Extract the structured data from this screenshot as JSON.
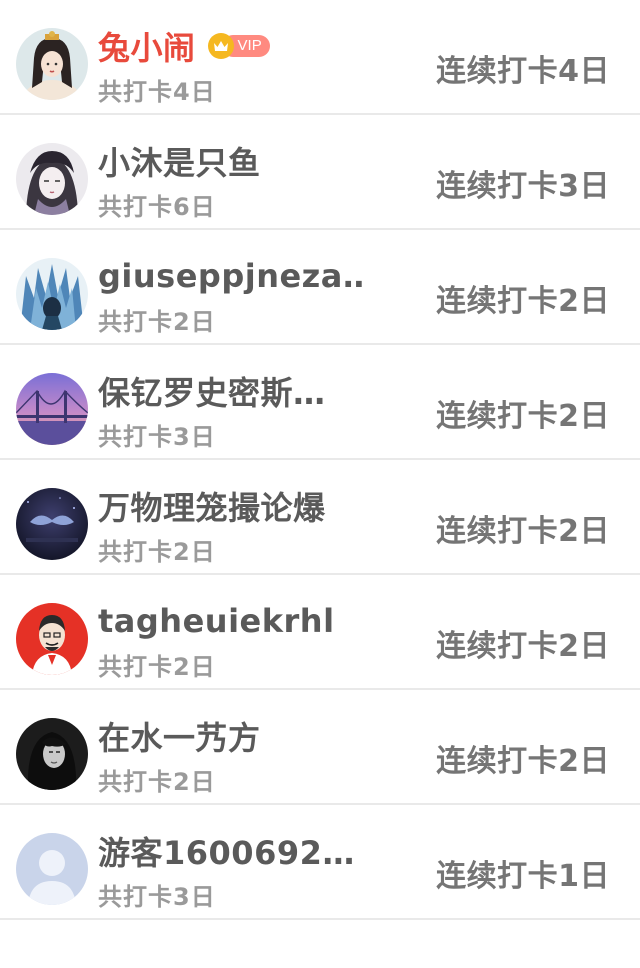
{
  "list": [
    {
      "name": "兔小闹",
      "vip": true,
      "vip_label": "VIP",
      "total": "共打卡4日",
      "streak": "连续打卡4日",
      "avatar": "avatar-girl-ancient-icon"
    },
    {
      "name": "小沐是只鱼",
      "vip": false,
      "total": "共打卡6日",
      "streak": "连续打卡3日",
      "avatar": "avatar-ink-girl-icon"
    },
    {
      "name": "giuseppjneza…",
      "vip": false,
      "total": "共打卡2日",
      "streak": "连续打卡2日",
      "avatar": "avatar-blue-hair-icon"
    },
    {
      "name": "保钇罗史密斯…",
      "vip": false,
      "total": "共打卡3日",
      "streak": "连续打卡2日",
      "avatar": "avatar-bridge-sunset-icon"
    },
    {
      "name": "万物理笼撮论爆",
      "vip": false,
      "total": "共打卡2日",
      "streak": "连续打卡2日",
      "avatar": "avatar-mustache-icon"
    },
    {
      "name": "tagheuiekrhl",
      "vip": false,
      "total": "共打卡2日",
      "streak": "连续打卡2日",
      "avatar": "avatar-red-man-icon"
    },
    {
      "name": "在水一艿方",
      "vip": false,
      "total": "共打卡2日",
      "streak": "连续打卡2日",
      "avatar": "avatar-dark-portrait-icon"
    },
    {
      "name": "游客1600692…",
      "vip": false,
      "total": "共打卡3日",
      "streak": "连续打卡1日",
      "avatar": "avatar-default-user-icon"
    }
  ],
  "colors": {
    "vip_name": "#e84a3c",
    "name": "#5a5a5a",
    "total": "#9a9a9a",
    "streak": "#757575",
    "divider": "#e9e9e9",
    "vip_crown": "#f5b820",
    "vip_label_bg": "#ff8a80"
  }
}
